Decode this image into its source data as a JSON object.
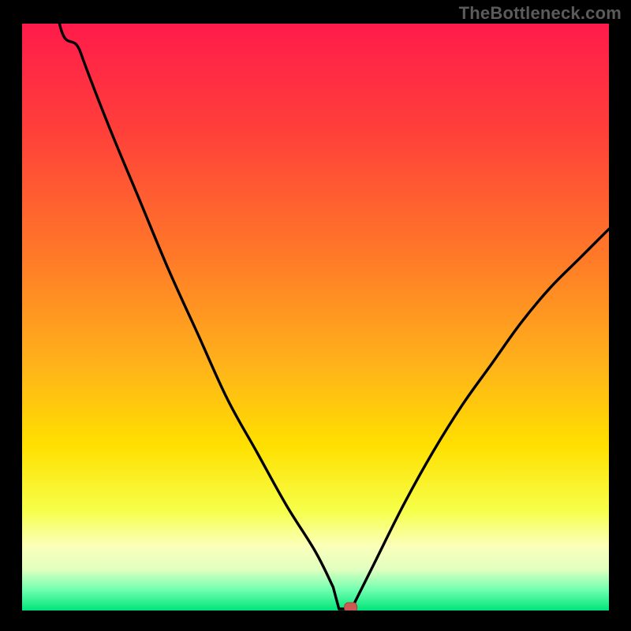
{
  "watermark": "TheBottleneck.com",
  "colors": {
    "frame": "#000000",
    "curve": "#000000",
    "marker_fill": "#cc5a52",
    "marker_stroke": "#a8463f",
    "gradient_stops": [
      {
        "offset": 0.0,
        "color": "#ff1b4b"
      },
      {
        "offset": 0.18,
        "color": "#ff3f3a"
      },
      {
        "offset": 0.4,
        "color": "#ff7a28"
      },
      {
        "offset": 0.58,
        "color": "#ffb21a"
      },
      {
        "offset": 0.72,
        "color": "#ffe000"
      },
      {
        "offset": 0.83,
        "color": "#f6ff4a"
      },
      {
        "offset": 0.89,
        "color": "#fbffba"
      },
      {
        "offset": 0.93,
        "color": "#e1ffc0"
      },
      {
        "offset": 0.965,
        "color": "#6fffb0"
      },
      {
        "offset": 1.0,
        "color": "#00e57a"
      }
    ]
  },
  "chart_data": {
    "type": "line",
    "title": "",
    "xlabel": "",
    "ylabel": "",
    "xlim": [
      0,
      100
    ],
    "ylim": [
      0,
      100
    ],
    "grid": false,
    "legend": false,
    "x_minimum": 55,
    "marker": {
      "x": 56,
      "y": 0
    },
    "series": [
      {
        "name": "bottleneck-curve",
        "x": [
          0,
          5,
          10,
          15,
          20,
          25,
          30,
          35,
          40,
          45,
          50,
          53,
          55,
          56,
          57,
          60,
          65,
          70,
          75,
          80,
          85,
          90,
          95,
          100
        ],
        "values": [
          200,
          110,
          95,
          82,
          70,
          58,
          47,
          36,
          27,
          18,
          10,
          4,
          0,
          0,
          2,
          8,
          18,
          27,
          35,
          42,
          49,
          55,
          60,
          65
        ]
      }
    ]
  }
}
